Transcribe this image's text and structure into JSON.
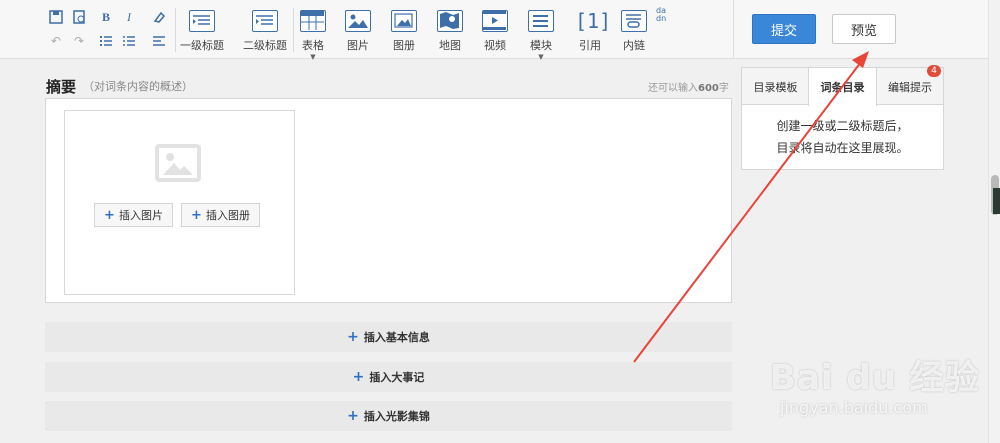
{
  "toolbar": {
    "small_tools": [
      {
        "name": "save-icon",
        "glyph": "▣"
      },
      {
        "name": "preview-doc-icon",
        "glyph": "◫"
      },
      {
        "name": "bold-icon",
        "glyph": "B"
      },
      {
        "name": "italic-icon",
        "glyph": "I"
      },
      {
        "name": "eraser-icon",
        "glyph": "⌫"
      },
      {
        "name": "undo-icon",
        "glyph": "↶"
      },
      {
        "name": "redo-icon",
        "glyph": "↷"
      },
      {
        "name": "ordered-list-icon",
        "glyph": "☰"
      },
      {
        "name": "unordered-list-icon",
        "glyph": "☷"
      },
      {
        "name": "align-left-icon",
        "glyph": "≡"
      }
    ],
    "big_tools": [
      {
        "id": "heading1",
        "label": "一级标题",
        "icon": "heading1-icon"
      },
      {
        "id": "heading2",
        "label": "二级标题",
        "icon": "heading2-icon"
      },
      {
        "id": "table",
        "label": "表格",
        "icon": "table-icon",
        "dropdown": true
      },
      {
        "id": "image",
        "label": "图片",
        "icon": "image-icon"
      },
      {
        "id": "album",
        "label": "图册",
        "icon": "album-icon"
      },
      {
        "id": "map",
        "label": "地图",
        "icon": "map-icon"
      },
      {
        "id": "video",
        "label": "视频",
        "icon": "video-icon"
      },
      {
        "id": "module",
        "label": "模块",
        "icon": "module-icon",
        "dropdown": true
      },
      {
        "id": "cite",
        "label": "引用",
        "icon": "cite-icon",
        "glyph": "[1]"
      },
      {
        "id": "innerlink",
        "label": "内链",
        "icon": "inner-link-icon"
      }
    ],
    "pinyin_glyph": "da dn"
  },
  "actions": {
    "submit_label": "提交",
    "preview_label": "预览"
  },
  "summary": {
    "title": "摘要",
    "description": "（对词条内容的概述）",
    "count_prefix": "还可以输入",
    "count_value": "600",
    "count_suffix": "字",
    "insert_image_label": "插入图片",
    "insert_album_label": "插入图册"
  },
  "insert_bars": [
    {
      "id": "basic-info",
      "label": "插入基本信息"
    },
    {
      "id": "events",
      "label": "插入大事记"
    },
    {
      "id": "gallery",
      "label": "插入光影集锦"
    }
  ],
  "right_panel": {
    "tabs": [
      {
        "id": "toc-template",
        "label": "目录模板"
      },
      {
        "id": "entry-toc",
        "label": "词条目录",
        "active": true
      },
      {
        "id": "edit-tips",
        "label": "编辑提示",
        "badge": "4"
      }
    ],
    "message_line1": "创建一级或二级标题后，",
    "message_line2": "目录将自动在这里展现。"
  },
  "watermark": {
    "main": "Bai du 经验",
    "sub": "jingyan.baidu.com"
  },
  "colors": {
    "accent": "#3a87d9",
    "arrow": "#e8443a",
    "badge": "#e24b3b"
  }
}
